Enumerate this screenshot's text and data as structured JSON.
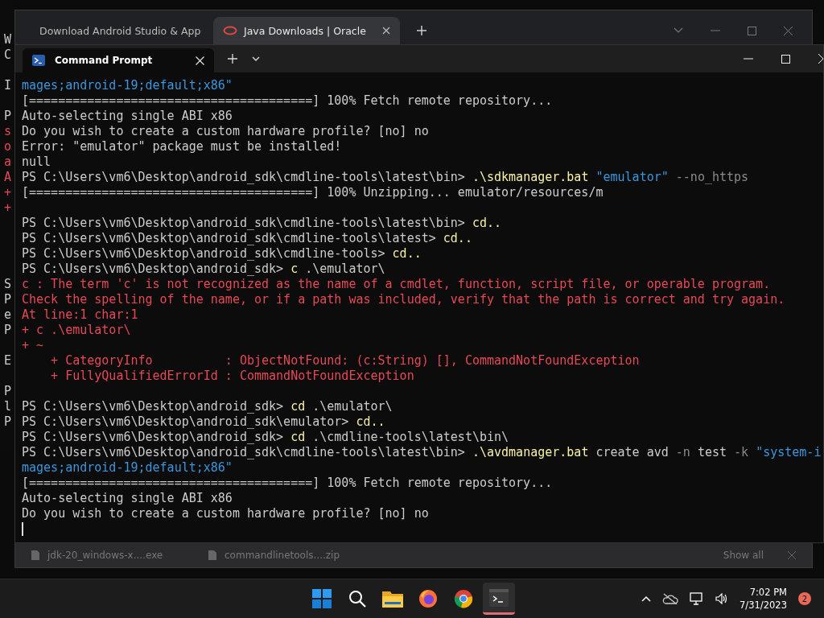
{
  "background_window": {
    "rows": [
      {
        "kind": "plain",
        "text": "W"
      },
      {
        "kind": "plain",
        "text": "C"
      },
      {
        "kind": "blank"
      },
      {
        "kind": "plain",
        "text": "I"
      },
      {
        "kind": "blank"
      },
      {
        "kind": "plain",
        "text": "P"
      },
      {
        "kind": "error",
        "text": "s"
      },
      {
        "kind": "error",
        "text": "o"
      },
      {
        "kind": "error",
        "text": "a"
      },
      {
        "kind": "error",
        "text": "A"
      },
      {
        "kind": "error",
        "text": "+"
      },
      {
        "kind": "error",
        "text": "+"
      },
      {
        "kind": "blank"
      },
      {
        "kind": "blank"
      },
      {
        "kind": "blank"
      },
      {
        "kind": "blank"
      },
      {
        "kind": "plain",
        "text": "S"
      },
      {
        "kind": "plain",
        "text": "P"
      },
      {
        "kind": "plain",
        "text": "e"
      },
      {
        "kind": "plain",
        "text": "P"
      },
      {
        "kind": "blank"
      },
      {
        "kind": "plain",
        "text": "E"
      },
      {
        "kind": "blank"
      },
      {
        "kind": "plain",
        "text": "P"
      },
      {
        "kind": "plain",
        "text": "l"
      },
      {
        "kind": "plain",
        "text": "P"
      }
    ]
  },
  "browser": {
    "tabs": [
      {
        "title": "Download Android Studio & App",
        "kind": "android",
        "selected": false
      },
      {
        "title": "Java Downloads | Oracle",
        "kind": "oracle",
        "selected": true
      }
    ],
    "downloads": [
      {
        "name": "jdk-20_windows-x....exe"
      },
      {
        "name": "commandlinetools....zip"
      }
    ],
    "show_all": "Show all"
  },
  "terminal": {
    "tabs": [
      {
        "title": "Command Prompt",
        "selected": true
      }
    ],
    "lines": [
      {
        "segments": [
          {
            "kind": "string",
            "text": "mages;android-19;default;x86\""
          }
        ]
      },
      {
        "segments": [
          {
            "kind": "plain",
            "text": "[=======================================] 100% Fetch remote repository..."
          }
        ]
      },
      {
        "segments": [
          {
            "kind": "plain",
            "text": "Auto-selecting single ABI x86"
          }
        ]
      },
      {
        "segments": [
          {
            "kind": "plain",
            "text": "Do you wish to create a custom hardware profile? [no] no"
          }
        ]
      },
      {
        "segments": [
          {
            "kind": "plain",
            "text": "Error: \"emulator\" package must be installed!"
          }
        ]
      },
      {
        "segments": [
          {
            "kind": "plain",
            "text": "null"
          }
        ]
      },
      {
        "segments": [
          {
            "kind": "plain",
            "text": "PS C:\\Users\\vm6\\Desktop\\android_sdk\\cmdline-tools\\latest\\bin> "
          },
          {
            "kind": "command",
            "text": ".\\sdkmanager.bat"
          },
          {
            "kind": "string",
            "text": " \"emulator\""
          },
          {
            "kind": "flag",
            "text": " --no_https"
          }
        ]
      },
      {
        "segments": [
          {
            "kind": "plain",
            "text": "[=======================================] 100% Unzipping... emulator/resources/m"
          }
        ]
      },
      {
        "kind": "blank"
      },
      {
        "segments": [
          {
            "kind": "plain",
            "text": "PS C:\\Users\\vm6\\Desktop\\android_sdk\\cmdline-tools\\latest\\bin> "
          },
          {
            "kind": "command",
            "text": "cd.."
          }
        ]
      },
      {
        "segments": [
          {
            "kind": "plain",
            "text": "PS C:\\Users\\vm6\\Desktop\\android_sdk\\cmdline-tools\\latest> "
          },
          {
            "kind": "command",
            "text": "cd.."
          }
        ]
      },
      {
        "segments": [
          {
            "kind": "plain",
            "text": "PS C:\\Users\\vm6\\Desktop\\android_sdk\\cmdline-tools> "
          },
          {
            "kind": "command",
            "text": "cd.."
          }
        ]
      },
      {
        "segments": [
          {
            "kind": "plain",
            "text": "PS C:\\Users\\vm6\\Desktop\\android_sdk> "
          },
          {
            "kind": "command",
            "text": "c"
          },
          {
            "kind": "plain",
            "text": " .\\emulator\\"
          }
        ]
      },
      {
        "segments": [
          {
            "kind": "error",
            "text": "c : The term 'c' is not recognized as the name of a cmdlet, function, script file, or operable program."
          }
        ]
      },
      {
        "segments": [
          {
            "kind": "error",
            "text": "Check the spelling of the name, or if a path was included, verify that the path is correct and try again."
          }
        ]
      },
      {
        "segments": [
          {
            "kind": "error",
            "text": "At line:1 char:1"
          }
        ]
      },
      {
        "segments": [
          {
            "kind": "error",
            "text": "+ c .\\emulator\\"
          }
        ]
      },
      {
        "segments": [
          {
            "kind": "error",
            "text": "+ ~"
          }
        ]
      },
      {
        "segments": [
          {
            "kind": "error",
            "text": "    + CategoryInfo          : ObjectNotFound: (c:String) [], CommandNotFoundException"
          }
        ]
      },
      {
        "segments": [
          {
            "kind": "error",
            "text": "    + FullyQualifiedErrorId : CommandNotFoundException"
          }
        ]
      },
      {
        "kind": "blank"
      },
      {
        "segments": [
          {
            "kind": "plain",
            "text": "PS C:\\Users\\vm6\\Desktop\\android_sdk> "
          },
          {
            "kind": "command",
            "text": "cd"
          },
          {
            "kind": "plain",
            "text": " .\\emulator\\"
          }
        ]
      },
      {
        "segments": [
          {
            "kind": "plain",
            "text": "PS C:\\Users\\vm6\\Desktop\\android_sdk\\emulator> "
          },
          {
            "kind": "command",
            "text": "cd.."
          }
        ]
      },
      {
        "segments": [
          {
            "kind": "plain",
            "text": "PS C:\\Users\\vm6\\Desktop\\android_sdk> "
          },
          {
            "kind": "command",
            "text": "cd"
          },
          {
            "kind": "plain",
            "text": " .\\cmdline-tools\\latest\\bin\\"
          }
        ]
      },
      {
        "segments": [
          {
            "kind": "plain",
            "text": "PS C:\\Users\\vm6\\Desktop\\android_sdk\\cmdline-tools\\latest\\bin> "
          },
          {
            "kind": "command",
            "text": ".\\avdmanager.bat"
          },
          {
            "kind": "plain",
            "text": " create avd "
          },
          {
            "kind": "flag",
            "text": "-n"
          },
          {
            "kind": "plain",
            "text": " test "
          },
          {
            "kind": "flag",
            "text": "-k"
          },
          {
            "kind": "string",
            "text": " \"system-i"
          }
        ]
      },
      {
        "segments": [
          {
            "kind": "string",
            "text": "mages;android-19;default;x86\""
          }
        ]
      },
      {
        "segments": [
          {
            "kind": "plain",
            "text": "[=======================================] 100% Fetch remote repository..."
          }
        ]
      },
      {
        "segments": [
          {
            "kind": "plain",
            "text": "Auto-selecting single ABI x86"
          }
        ]
      },
      {
        "segments": [
          {
            "kind": "plain",
            "text": "Do you wish to create a custom hardware profile? [no] no"
          }
        ]
      }
    ]
  },
  "taskbar": {
    "apps": [
      {
        "kind": "start",
        "active": false
      },
      {
        "kind": "search",
        "active": false
      },
      {
        "kind": "files",
        "active": false
      },
      {
        "kind": "firefox",
        "active": false
      },
      {
        "kind": "chrome",
        "active": false
      },
      {
        "kind": "terminal",
        "active": true
      }
    ],
    "time": "7:02 PM",
    "date": "7/31/2023",
    "notifications": "2"
  }
}
